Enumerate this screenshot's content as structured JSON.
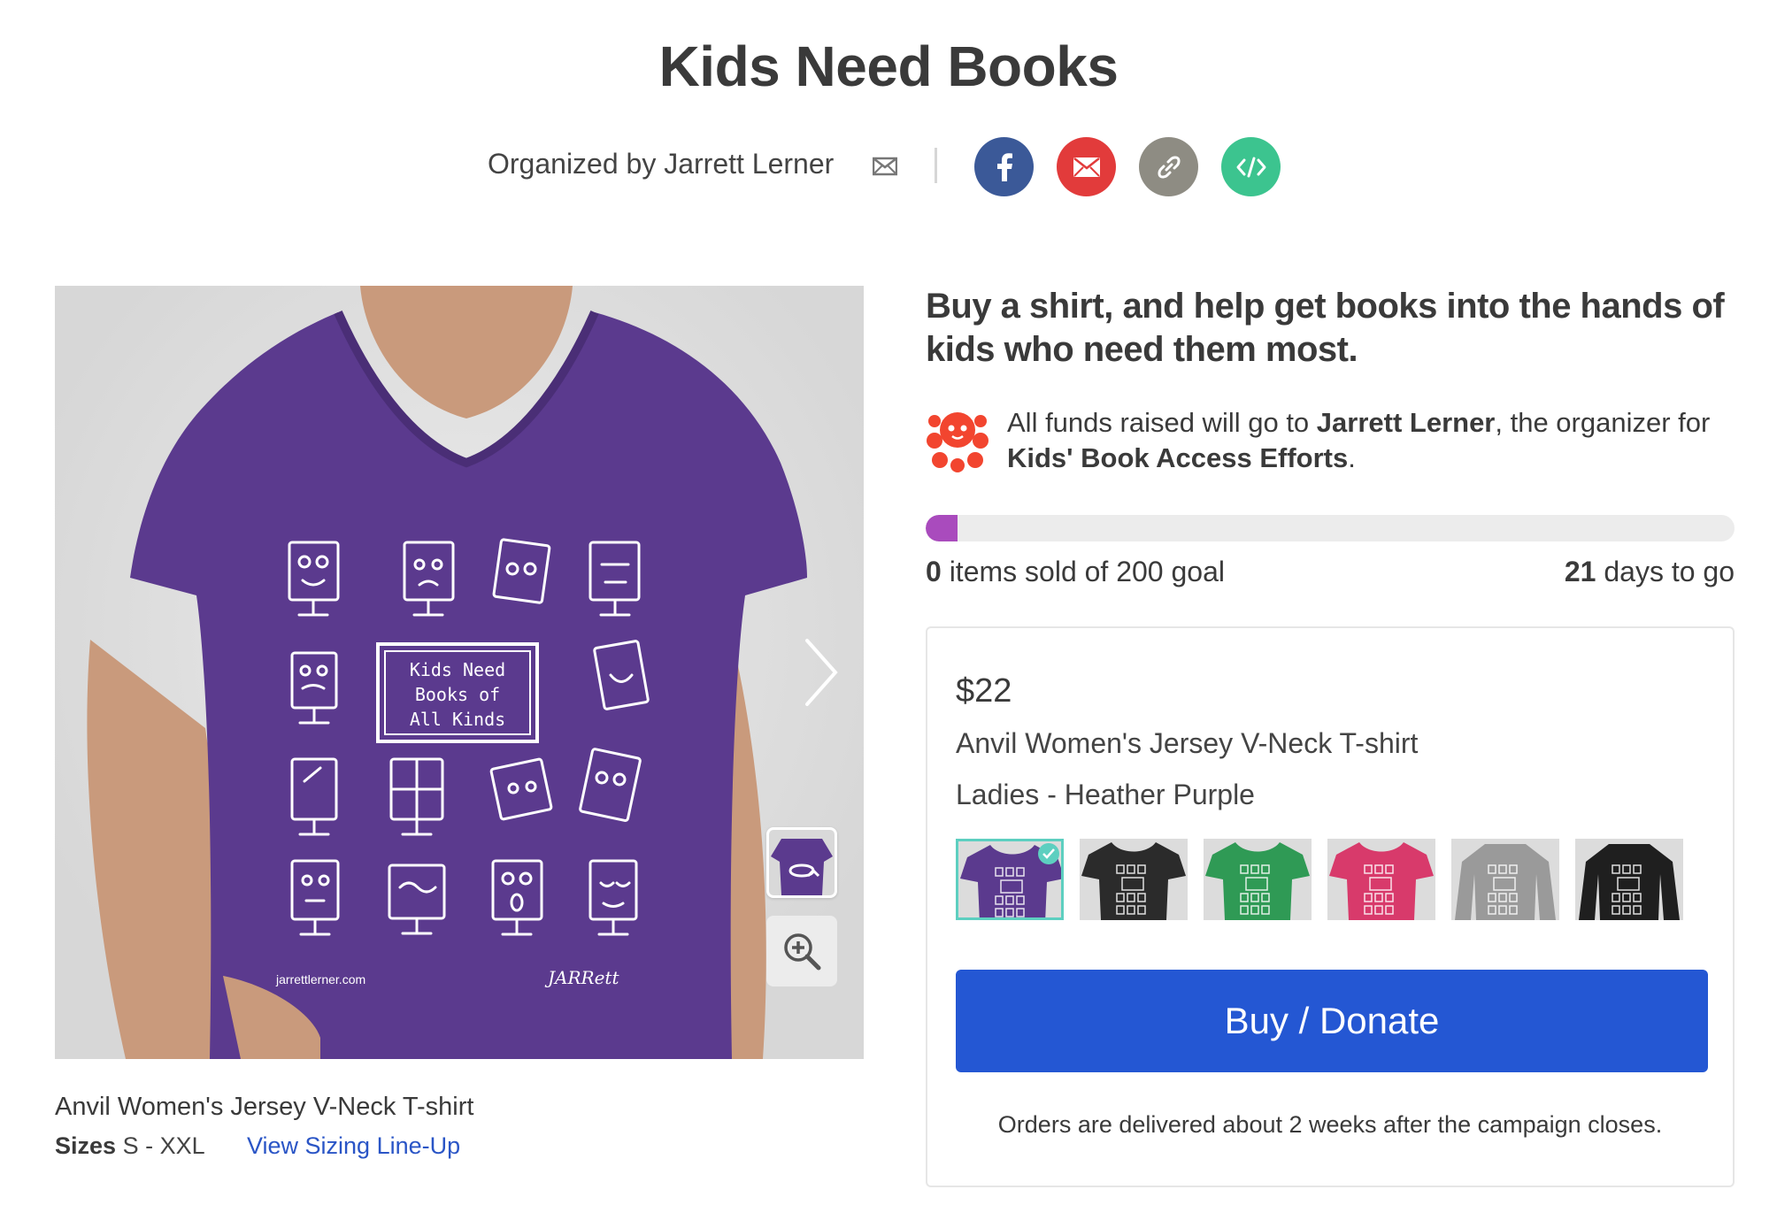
{
  "page": {
    "title": "Kids Need Books"
  },
  "organizer": {
    "label": "Organized by Jarrett Lerner"
  },
  "share": {
    "colors": {
      "facebook": "#3b5998",
      "email": "#e23b3b",
      "link": "#8e8c83",
      "embed": "#3cc48f"
    }
  },
  "product_image": {
    "shirt_color": "#5b3a8e",
    "print_text": "Kids Need Books of All Kinds",
    "website_text": "jarrettlerner.com",
    "signature_text": "JARRett"
  },
  "caption": {
    "product_name": "Anvil Women's Jersey V-Neck T-shirt",
    "sizes_label": "Sizes",
    "sizes_value": "S - XXL",
    "sizing_link": "View Sizing Line-Up"
  },
  "campaign": {
    "headline": "Buy a shirt, and help get books into the hands of kids who need them most.",
    "funds_prefix": "All funds raised will go to ",
    "funds_recipient": "Jarrett Lerner",
    "funds_middle": ", the organizer for ",
    "funds_cause": "Kids' Book Access Efforts",
    "funds_suffix": "."
  },
  "progress": {
    "fraction": 0.0,
    "sold_count": "0",
    "sold_suffix": " items sold of 200 goal",
    "days_count": "21",
    "days_suffix": " days to go",
    "fill_color": "#a94bbd"
  },
  "card": {
    "price": "$22",
    "product": "Anvil Women's Jersey V-Neck T-shirt",
    "color_name": "Ladies - Heather Purple",
    "swatches": [
      {
        "name": "heather-purple-vneck",
        "color": "#5b3a8e",
        "selected": true
      },
      {
        "name": "black-vneck",
        "color": "#2b2b2b",
        "selected": false
      },
      {
        "name": "green-vneck",
        "color": "#2f9a55",
        "selected": false
      },
      {
        "name": "pink-vneck",
        "color": "#d83a6b",
        "selected": false
      },
      {
        "name": "gray-longsleeve",
        "color": "#9a9a9a",
        "selected": false
      },
      {
        "name": "black-longsleeve",
        "color": "#1f1f1f",
        "selected": false
      }
    ],
    "buy_label": "Buy / Donate",
    "delivery_note": "Orders are delivered about 2 weeks after the campaign closes."
  }
}
